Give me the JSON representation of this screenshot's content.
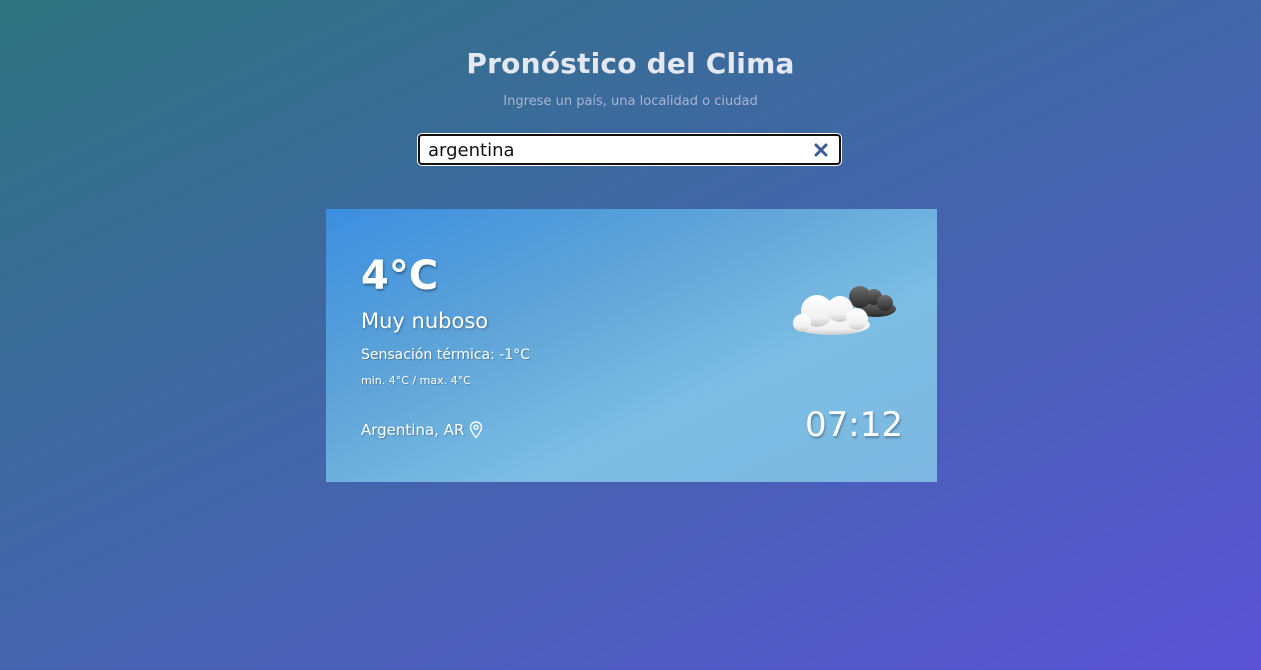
{
  "header": {
    "title": "Pronóstico del Clima",
    "subtitle": "Ingrese un país, una localidad o ciudad"
  },
  "search": {
    "value": "argentina",
    "clear_icon": "close-icon"
  },
  "weather": {
    "temperature": "4°C",
    "description": "Muy nuboso",
    "feels_like": "Sensación térmica: -1°C",
    "min_max": "min. 4°C / max. 4°C",
    "location": "Argentina, AR",
    "time": "07:12",
    "icon": "cloudy-icon",
    "location_icon": "map-pin-icon"
  }
}
